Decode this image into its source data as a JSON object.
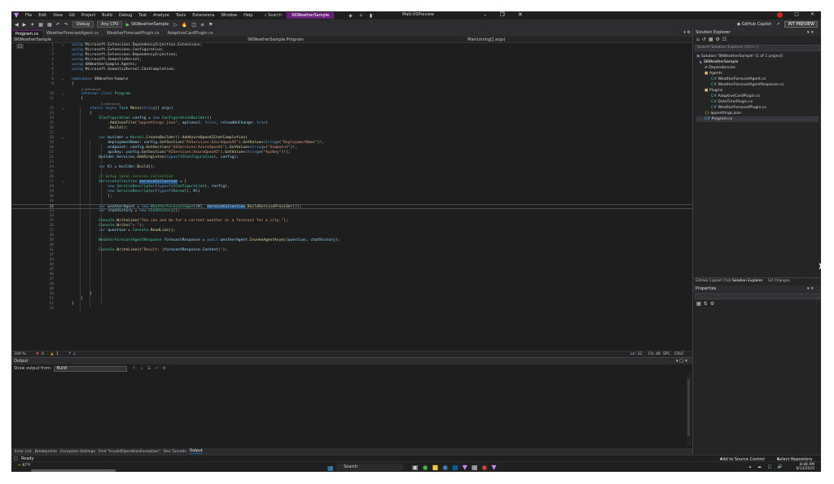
{
  "titlebar": {
    "menus": [
      "File",
      "Edit",
      "View",
      "Git",
      "Project",
      "Build",
      "Debug",
      "Test",
      "Analyze",
      "Tools",
      "Extensions",
      "Window",
      "Help"
    ],
    "search": "Search",
    "solution_name": "SKWeatherSample",
    "window_title": "Matt-VSPreview"
  },
  "toolbar": {
    "config": "Debug",
    "platform": "Any CPU",
    "startup": "SKWeatherSample",
    "copilot": "GitHub Copilot",
    "preview_button": "INT PREVIEW"
  },
  "tabs": [
    {
      "label": "Program.cs",
      "active": true
    },
    {
      "label": "WeatherForecastAgent.cs",
      "active": false
    },
    {
      "label": "WeatherForecastPlugin.cs",
      "active": false
    },
    {
      "label": "AdaptiveCardPlugin.cs",
      "active": false
    }
  ],
  "navbar": {
    "project": "SKWeatherSample",
    "class": "SKWeatherSample.Program",
    "member": "Main(string[] args)"
  },
  "editor": {
    "references_lens": "0 references"
  },
  "edstatus": {
    "zoom": "100 %",
    "errors": "0",
    "warnings": "1",
    "position": "Ln: 32",
    "column": "Ch: 48",
    "spc": "SPC",
    "crlf": "CRLF"
  },
  "output": {
    "title": "Output",
    "show_from_label": "Show output from:",
    "source": "Build"
  },
  "bottom_tabs": [
    "Error List",
    "Breakpoints",
    "Exception Settings",
    "Find \"InvalidOperationException\"",
    "Dev Tunnels",
    "Output"
  ],
  "solution_explorer": {
    "title": "Solution Explorer",
    "search_placeholder": "Search Solution Explorer (Ctrl+;)",
    "solution": "Solution 'SKWeatherSample' (1 of 1 project)",
    "project": "SKWeatherSample",
    "items": [
      {
        "label": "Dependencies",
        "kind": "dep"
      },
      {
        "label": "Agents",
        "kind": "folder"
      },
      {
        "label": "WeatherForecastAgent.cs",
        "kind": "cs"
      },
      {
        "label": "WeatherForecastAgentResponse.cs",
        "kind": "cs"
      },
      {
        "label": "Plugins",
        "kind": "folder"
      },
      {
        "label": "AdaptiveCardPlugin.cs",
        "kind": "cs"
      },
      {
        "label": "DateTimePlugin.cs",
        "kind": "cs"
      },
      {
        "label": "WeatherForecastPlugin.cs",
        "kind": "cs"
      },
      {
        "label": "appsettings.json",
        "kind": "json"
      },
      {
        "label": "Program.cs",
        "kind": "cs"
      }
    ],
    "tabs": [
      "GitHub Copilot Chat",
      "Solution Explorer",
      "Git Changes"
    ],
    "properties": "Properties"
  },
  "statusbar": {
    "ready": "Ready",
    "add_source": "Add to Source Control",
    "select_repo": "Select Repository"
  },
  "taskbar": {
    "temp": "67°F",
    "search": "Search",
    "time": "8:48 AM",
    "date": "6/13/2025"
  }
}
